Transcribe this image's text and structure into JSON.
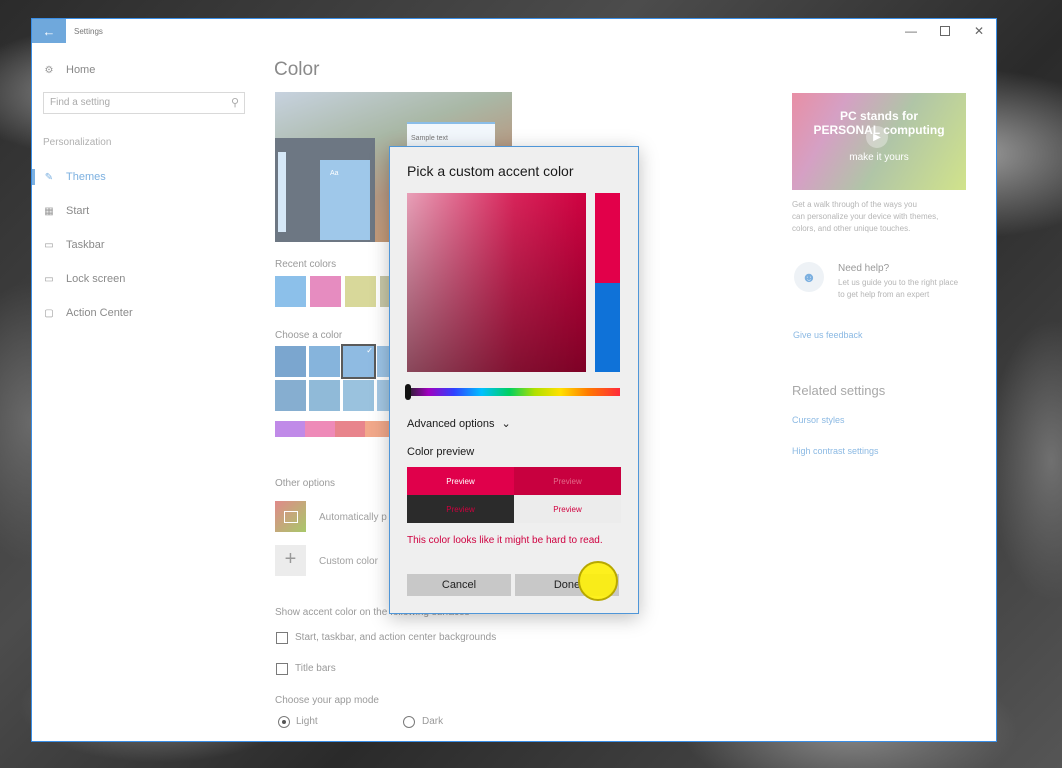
{
  "window": {
    "title": "Settings"
  },
  "sidebar": {
    "home": "Home",
    "search_placeholder": "Find a setting",
    "section": "Personalization",
    "items": [
      {
        "label": "Themes",
        "icon": "themes-icon",
        "active": true
      },
      {
        "label": "Start",
        "icon": "start-icon"
      },
      {
        "label": "Taskbar",
        "icon": "taskbar-icon"
      },
      {
        "label": "Lock screen",
        "icon": "lock-screen-icon"
      },
      {
        "label": "Action Center",
        "icon": "action-center-icon"
      }
    ]
  },
  "main": {
    "title": "Color",
    "preview_sample_text": "Sample text",
    "preview_tile_text": "Aa",
    "recent_colors_label": "Recent colors",
    "recent_colors": [
      "#8cc0ea",
      "#e68cc0",
      "#d8d89a",
      "#c8c8a8"
    ],
    "choose_color_label": "Choose a color",
    "grid_colors": [
      [
        "#7ba6cf",
        "#86b4dc",
        "#8fbbe2",
        "#9cc4e6"
      ],
      [
        "#86aed0",
        "#90bad8",
        "#9ac2de",
        "#a4c8e4"
      ]
    ],
    "strip_colors": [
      "#c08ae8",
      "#ee8ab8",
      "#e8848c",
      "#f2a88a"
    ],
    "other_options_label": "Other options",
    "auto_pick_text": "Automatically p",
    "custom_color_label": "Custom color",
    "show_accent_label": "Show accent color on the following surfaces",
    "checkbox_start": "Start, taskbar, and action center backgrounds",
    "checkbox_titlebars": "Title bars",
    "app_mode_label": "Choose your app mode",
    "mode_light": "Light",
    "mode_dark": "Dark"
  },
  "right": {
    "promo_line1": "PC stands for",
    "promo_line2": "PERSONAL computing",
    "promo_line3": "make it yours",
    "promo_desc": [
      "Get a walk through of the ways you",
      "can personalize your device with themes,",
      "colors, and other unique touches."
    ],
    "help_title": "Need help?",
    "help_desc": [
      "Let us guide you to the right place",
      "to get help from an expert"
    ],
    "feedback": "Give us feedback",
    "related_heading": "Related settings",
    "related_links": [
      "Cursor styles",
      "High contrast settings"
    ]
  },
  "dialog": {
    "title": "Pick a custom accent color",
    "advanced": "Advanced options",
    "color_preview": "Color preview",
    "preview_boxes": [
      {
        "text": "Preview",
        "bg": "#e0004b",
        "fg": "#ffffff"
      },
      {
        "text": "Preview",
        "bg": "#c8003f",
        "fg": "#e46a8a"
      },
      {
        "text": "Preview",
        "bg": "#2b2b2b",
        "fg": "#d0003f"
      },
      {
        "text": "Preview",
        "bg": "#ececec",
        "fg": "#d0003f"
      }
    ],
    "warning": "This color looks like it might be hard to read.",
    "cancel": "Cancel",
    "done": "Done",
    "accent_color": "#e0004b"
  }
}
